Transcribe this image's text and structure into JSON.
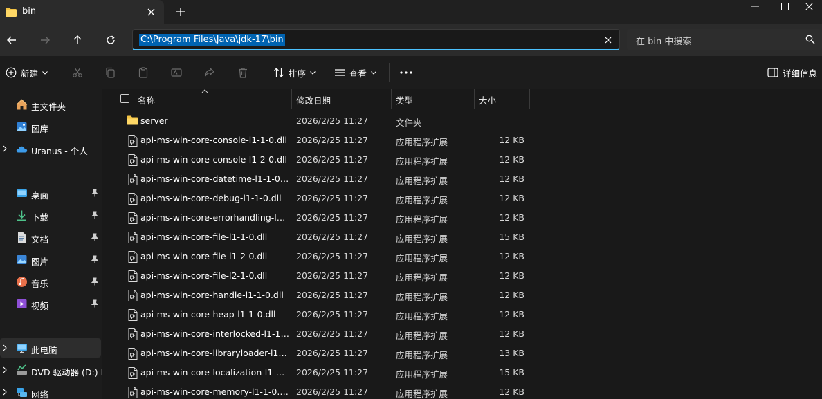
{
  "window": {
    "tab_title": "bin",
    "icons": {
      "folder": "folder-icon",
      "close": "close-icon",
      "new_tab": "plus-icon",
      "minimize": "minimize-icon",
      "maximize": "maximize-icon",
      "close_window": "close-window-icon"
    }
  },
  "address_bar": {
    "path": "C:\\Program Files\\Java\\jdk-17\\bin",
    "search_placeholder": "在 bin 中搜索"
  },
  "toolbar": {
    "new_label": "新建",
    "sort_label": "排序",
    "view_label": "查看",
    "details_label": "详细信息"
  },
  "sidebar": {
    "items": [
      {
        "label": "主文件夹",
        "icon": "home-icon"
      },
      {
        "label": "图库",
        "icon": "gallery-icon"
      },
      {
        "label": "Uranus - 个人",
        "icon": "cloud-icon"
      },
      {
        "label": "桌面",
        "icon": "desktop-icon"
      },
      {
        "label": "下载",
        "icon": "download-icon"
      },
      {
        "label": "文档",
        "icon": "document-icon"
      },
      {
        "label": "图片",
        "icon": "pictures-icon"
      },
      {
        "label": "音乐",
        "icon": "music-icon"
      },
      {
        "label": "视频",
        "icon": "video-icon"
      },
      {
        "label": "此电脑",
        "icon": "computer-icon"
      },
      {
        "label": "DVD 驱动器 (D:) E",
        "icon": "dvd-icon"
      },
      {
        "label": "网络",
        "icon": "network-icon"
      }
    ]
  },
  "columns": {
    "name": "名称",
    "date": "修改日期",
    "type": "类型",
    "size": "大小"
  },
  "files": [
    {
      "name": "server",
      "date": "2026/2/25 11:27",
      "type": "文件夹",
      "size": "",
      "kind": "folder"
    },
    {
      "name": "api-ms-win-core-console-l1-1-0.dll",
      "date": "2026/2/25 11:27",
      "type": "应用程序扩展",
      "size": "12 KB",
      "kind": "file"
    },
    {
      "name": "api-ms-win-core-console-l1-2-0.dll",
      "date": "2026/2/25 11:27",
      "type": "应用程序扩展",
      "size": "12 KB",
      "kind": "file"
    },
    {
      "name": "api-ms-win-core-datetime-l1-1-0.dll",
      "date": "2026/2/25 11:27",
      "type": "应用程序扩展",
      "size": "12 KB",
      "kind": "file"
    },
    {
      "name": "api-ms-win-core-debug-l1-1-0.dll",
      "date": "2026/2/25 11:27",
      "type": "应用程序扩展",
      "size": "12 KB",
      "kind": "file"
    },
    {
      "name": "api-ms-win-core-errorhandling-l1-...",
      "date": "2026/2/25 11:27",
      "type": "应用程序扩展",
      "size": "12 KB",
      "kind": "file"
    },
    {
      "name": "api-ms-win-core-file-l1-1-0.dll",
      "date": "2026/2/25 11:27",
      "type": "应用程序扩展",
      "size": "15 KB",
      "kind": "file"
    },
    {
      "name": "api-ms-win-core-file-l1-2-0.dll",
      "date": "2026/2/25 11:27",
      "type": "应用程序扩展",
      "size": "12 KB",
      "kind": "file"
    },
    {
      "name": "api-ms-win-core-file-l2-1-0.dll",
      "date": "2026/2/25 11:27",
      "type": "应用程序扩展",
      "size": "12 KB",
      "kind": "file"
    },
    {
      "name": "api-ms-win-core-handle-l1-1-0.dll",
      "date": "2026/2/25 11:27",
      "type": "应用程序扩展",
      "size": "12 KB",
      "kind": "file"
    },
    {
      "name": "api-ms-win-core-heap-l1-1-0.dll",
      "date": "2026/2/25 11:27",
      "type": "应用程序扩展",
      "size": "12 KB",
      "kind": "file"
    },
    {
      "name": "api-ms-win-core-interlocked-l1-1-...",
      "date": "2026/2/25 11:27",
      "type": "应用程序扩展",
      "size": "12 KB",
      "kind": "file"
    },
    {
      "name": "api-ms-win-core-libraryloader-l1-1...",
      "date": "2026/2/25 11:27",
      "type": "应用程序扩展",
      "size": "13 KB",
      "kind": "file"
    },
    {
      "name": "api-ms-win-core-localization-l1-2-...",
      "date": "2026/2/25 11:27",
      "type": "应用程序扩展",
      "size": "15 KB",
      "kind": "file"
    },
    {
      "name": "api-ms-win-core-memory-l1-1-0.dll",
      "date": "2026/2/25 11:27",
      "type": "应用程序扩展",
      "size": "12 KB",
      "kind": "file"
    }
  ]
}
